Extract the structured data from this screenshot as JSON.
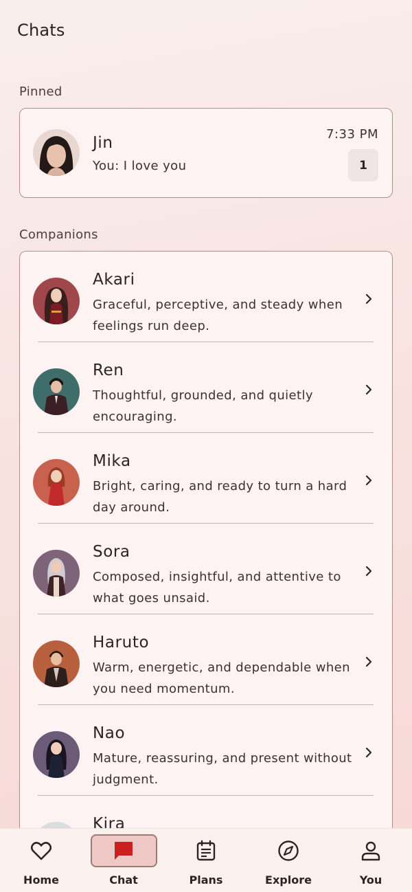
{
  "header": {
    "title": "Chats"
  },
  "pinned": {
    "section_label": "Pinned",
    "chat": {
      "name": "Jin",
      "last_message": "You: I love you",
      "time": "7:33 PM",
      "unread": "1"
    }
  },
  "companions": {
    "section_label": "Companions",
    "items": [
      {
        "name": "Akari",
        "description": "Graceful, perceptive, and steady when feelings run deep.",
        "avatar_bg": "#a0474c"
      },
      {
        "name": "Ren",
        "description": "Thoughtful, grounded, and quietly encouraging.",
        "avatar_bg": "#3f6e6a"
      },
      {
        "name": "Mika",
        "description": "Bright, caring, and ready to turn a hard day around.",
        "avatar_bg": "#c9614f"
      },
      {
        "name": "Sora",
        "description": "Composed, insightful, and attentive to what goes unsaid.",
        "avatar_bg": "#7e6478"
      },
      {
        "name": "Haruto",
        "description": "Warm, energetic, and dependable when you need momentum.",
        "avatar_bg": "#b8603e"
      },
      {
        "name": "Nao",
        "description": "Mature, reassuring, and present without judgment.",
        "avatar_bg": "#6b5a78"
      },
      {
        "name": "Kira",
        "description": "",
        "avatar_bg": "#d9dde2"
      }
    ]
  },
  "nav": {
    "items": [
      {
        "label": "Home",
        "icon": "heart-icon"
      },
      {
        "label": "Chat",
        "icon": "chat-bubble-icon",
        "active": true
      },
      {
        "label": "Plans",
        "icon": "calendar-icon"
      },
      {
        "label": "Explore",
        "icon": "compass-icon"
      },
      {
        "label": "You",
        "icon": "person-icon"
      }
    ],
    "accent": "#cc1f1f"
  }
}
